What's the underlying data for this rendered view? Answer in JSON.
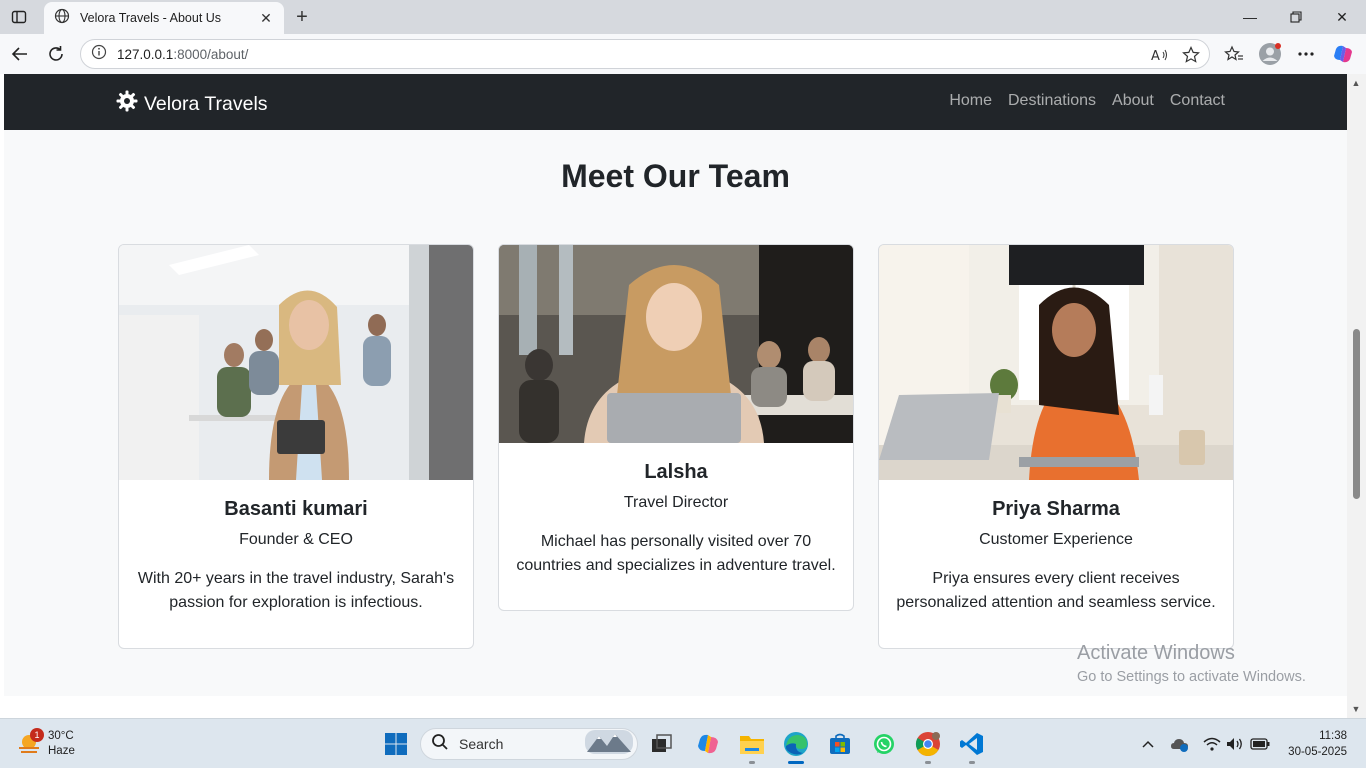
{
  "browser": {
    "tab_title": "Velora Travels - About Us",
    "url": "127.0.0.1:8000/about/",
    "url_host": "127.0.0.1",
    "url_rest": ":8000/about/"
  },
  "site": {
    "brand": "Velora Travels",
    "nav": [
      "Home",
      "Destinations",
      "About",
      "Contact"
    ],
    "section_title": "Meet Our Team",
    "team": [
      {
        "name": "Basanti kumari",
        "role": "Founder & CEO",
        "desc": "With 20+ years in the travel industry, Sarah's passion for exploration is infectious."
      },
      {
        "name": "Lalsha",
        "role": "Travel Director",
        "desc": "Michael has personally visited over 70 countries and specializes in adventure travel."
      },
      {
        "name": "Priya Sharma",
        "role": "Customer Experience",
        "desc": "Priya ensures every client receives personalized attention and seamless service."
      }
    ]
  },
  "watermark": {
    "title": "Activate Windows",
    "subtitle": "Go to Settings to activate Windows."
  },
  "taskbar": {
    "weather_temp": "30°C",
    "weather_desc": "Haze",
    "weather_badge": "1",
    "search_placeholder": "Search",
    "time": "11:38",
    "date": "30-05-2025"
  },
  "colors": {
    "navbar_bg": "#212529",
    "page_bg": "#f8f9fa",
    "accent": "#0067c0"
  }
}
